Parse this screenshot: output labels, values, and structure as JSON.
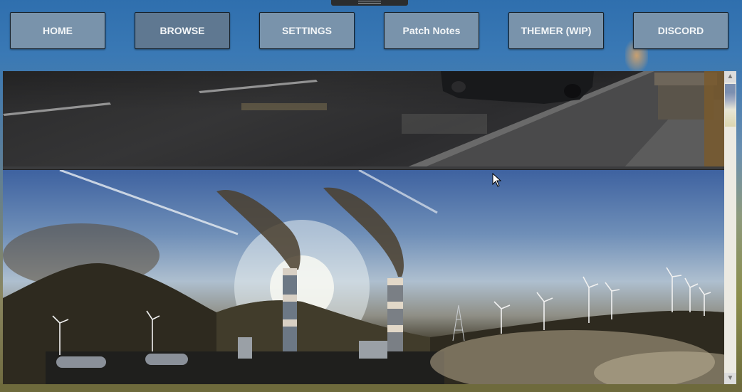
{
  "nav": {
    "buttons": [
      {
        "label": "HOME"
      },
      {
        "label": "BROWSE"
      },
      {
        "label": "SETTINGS"
      },
      {
        "label": "Patch Notes"
      },
      {
        "label": "THEMER (WIP)"
      },
      {
        "label": "DISCORD"
      }
    ]
  },
  "icons": {
    "scroll_up": "scroll-up-arrow-icon",
    "scroll_down": "scroll-down-arrow-icon",
    "pointer": "mouse-pointer-icon"
  },
  "colors": {
    "button_bg": "#7993ab",
    "button_active_bg": "#5f7891",
    "button_text": "#f3f6f8"
  }
}
